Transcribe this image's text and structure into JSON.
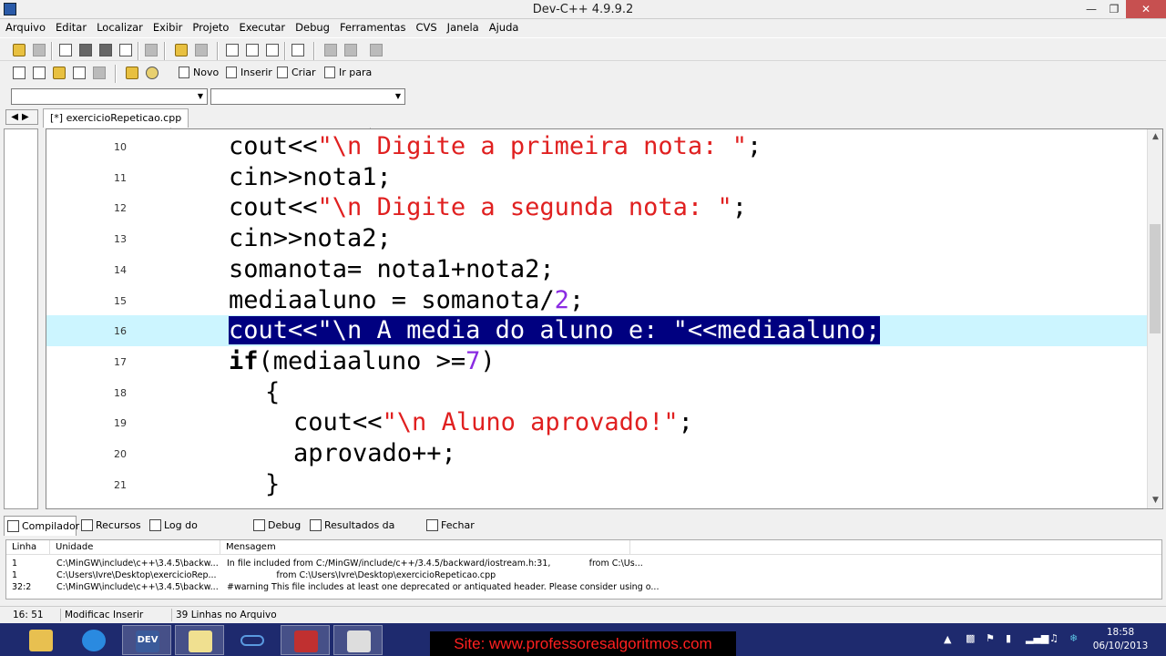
{
  "window": {
    "title": "Dev-C++ 4.9.9.2"
  },
  "menu": [
    "Arquivo",
    "Editar",
    "Localizar",
    "Exibir",
    "Projeto",
    "Executar",
    "Debug",
    "Ferramentas",
    "CVS",
    "Janela",
    "Ajuda"
  ],
  "toolbar2": {
    "novo": "Novo",
    "inserir": "Inserir",
    "criar": "Criar",
    "ir_para": "Ir para"
  },
  "tab": {
    "label": "[*] exercicioRepeticao.cpp"
  },
  "editor": {
    "lines": [
      {
        "n": "10",
        "code": [
          {
            "t": "cout<<"
          },
          {
            "t": "\"\\n Digite a primeira nota: \"",
            "c": "str"
          },
          {
            "t": ";"
          }
        ]
      },
      {
        "n": "11",
        "code": [
          {
            "t": "cin>>nota1;"
          }
        ]
      },
      {
        "n": "12",
        "code": [
          {
            "t": "cout<<"
          },
          {
            "t": "\"\\n Digite a segunda nota: \"",
            "c": "str"
          },
          {
            "t": ";"
          }
        ]
      },
      {
        "n": "13",
        "code": [
          {
            "t": "cin>>nota2;"
          }
        ]
      },
      {
        "n": "14",
        "code": [
          {
            "t": "somanota= nota1+nota2;"
          }
        ]
      },
      {
        "n": "15",
        "code": [
          {
            "t": "mediaaluno = somanota/"
          },
          {
            "t": "2",
            "c": "num"
          },
          {
            "t": ";"
          }
        ]
      },
      {
        "n": "16",
        "code": [
          {
            "t": "cout<<\"\\n A media do aluno e: \"<<mediaaluno;",
            "c": "sel"
          }
        ]
      },
      {
        "n": "17",
        "code": [
          {
            "t": "if",
            "c": "kw"
          },
          {
            "t": "(mediaaluno >="
          },
          {
            "t": "7",
            "c": "num"
          },
          {
            "t": ")"
          }
        ]
      },
      {
        "n": "18",
        "code": [
          {
            "t": "{"
          }
        ]
      },
      {
        "n": "19",
        "code": [
          {
            "t": "cout<<"
          },
          {
            "t": "\"\\n Aluno aprovado!\"",
            "c": "str"
          },
          {
            "t": ";"
          }
        ]
      },
      {
        "n": "20",
        "code": [
          {
            "t": "aprovado++;"
          }
        ]
      },
      {
        "n": "21",
        "code": [
          {
            "t": "}"
          }
        ]
      }
    ]
  },
  "bottom_tabs": [
    "Compilador",
    "Recursos",
    "Log do Compilador",
    "Debug",
    "Resultados da Busca",
    "Fechar"
  ],
  "messages": {
    "headers": [
      "Linha",
      "Unidade",
      "Mensagem"
    ],
    "rows": [
      [
        "1",
        "C:\\MinGW\\include\\c++\\3.4.5\\backw...",
        "In file included from C:/MinGW/include/c++/3.4.5/backward/iostream.h:31,              from C:\\Us..."
      ],
      [
        "1",
        "C:\\Users\\Ivre\\Desktop\\exercicioRep...",
        "                  from C:\\Users\\Ivre\\Desktop\\exercicioRepeticao.cpp"
      ],
      [
        "32:2",
        "C:\\MinGW\\include\\c++\\3.4.5\\backw...",
        "#warning This file includes at least one deprecated or antiquated header. Please consider using o..."
      ]
    ]
  },
  "status": {
    "position": "16: 51",
    "mode": "Modificac Inserir",
    "lines": "39 Linhas no Arquivo"
  },
  "taskbar": {
    "site": "Site: www.professoresalgoritmos.com",
    "time": "18:58",
    "date": "06/10/2013",
    "dev_label": "DEV"
  },
  "colors": {
    "string": "#e02020",
    "number": "#8a2be2",
    "selection": "#000080",
    "active_line": "#ccf5ff",
    "taskbar": "#1e2a6e"
  }
}
